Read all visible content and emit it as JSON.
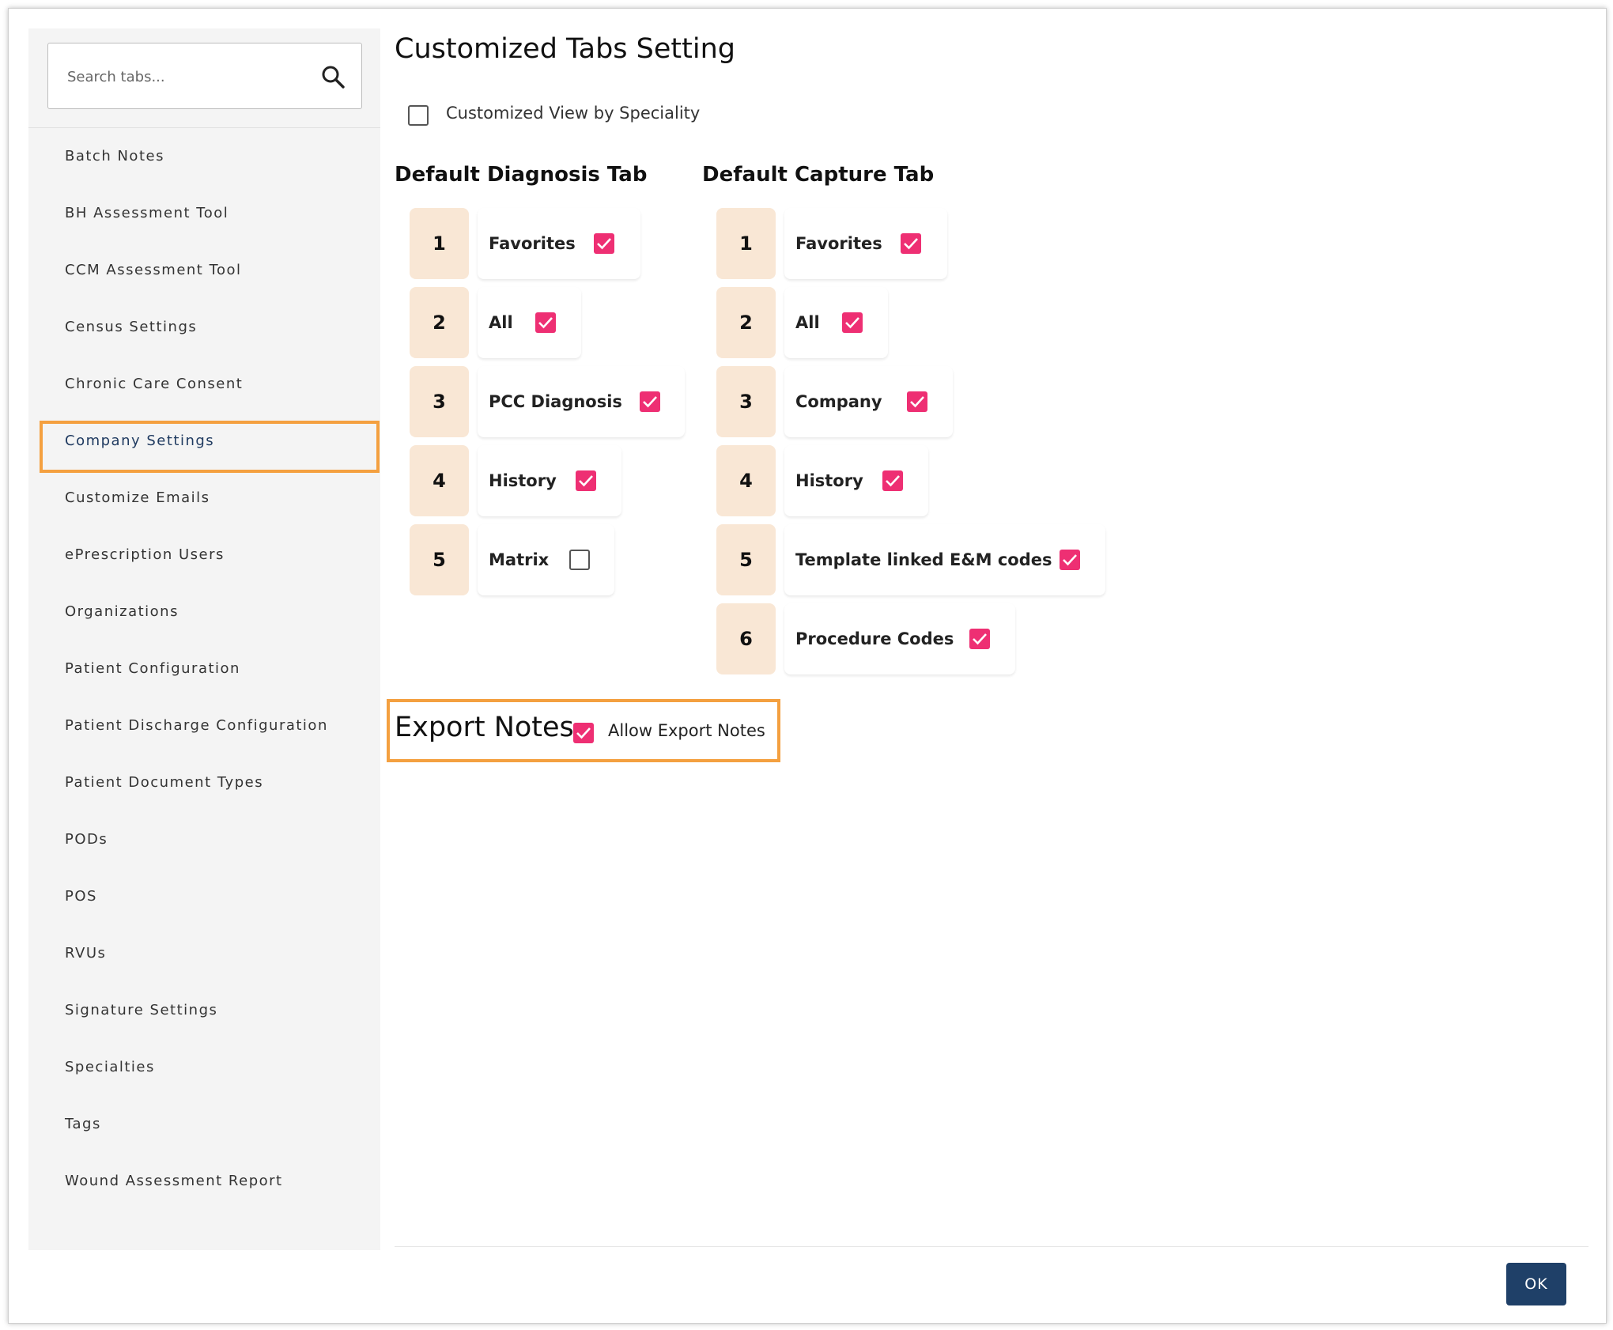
{
  "sidebar": {
    "search_placeholder": "Search tabs...",
    "items": [
      "Batch Notes",
      "BH Assessment Tool",
      "CCM Assessment Tool",
      "Census Settings",
      "Chronic Care Consent",
      "Company Settings",
      "Customize Emails",
      "ePrescription Users",
      "Organizations",
      "Patient Configuration",
      "Patient Discharge Configuration",
      "Patient Document Types",
      "PODs",
      "POS",
      "RVUs",
      "Signature Settings",
      "Specialties",
      "Tags",
      "Wound Assessment Report"
    ],
    "active_item": "Company Settings"
  },
  "main": {
    "title": "Customized Tabs Setting",
    "customized_view_label": "Customized View by Speciality",
    "customized_view_checked": false,
    "diagnosis": {
      "heading": "Default Diagnosis Tab",
      "tabs": [
        {
          "num": "1",
          "label": "Favorites",
          "checked": true
        },
        {
          "num": "2",
          "label": "All",
          "checked": true
        },
        {
          "num": "3",
          "label": "PCC Diagnosis",
          "checked": true
        },
        {
          "num": "4",
          "label": "History",
          "checked": true
        },
        {
          "num": "5",
          "label": "Matrix",
          "checked": false
        }
      ]
    },
    "capture": {
      "heading": "Default Capture Tab",
      "tabs": [
        {
          "num": "1",
          "label": "Favorites",
          "checked": true
        },
        {
          "num": "2",
          "label": "All",
          "checked": true
        },
        {
          "num": "3",
          "label": "Company",
          "checked": true
        },
        {
          "num": "4",
          "label": "History",
          "checked": true
        },
        {
          "num": "5",
          "label": "Template linked E&M codes",
          "checked": true
        },
        {
          "num": "6",
          "label": "Procedure Codes",
          "checked": true
        }
      ]
    },
    "export": {
      "title": "Export Notes",
      "label": "Allow Export Notes",
      "checked": true
    }
  },
  "footer": {
    "ok_label": "OK"
  },
  "colors": {
    "accent_checkbox": "#ee2f73",
    "highlight": "#f4a040",
    "number_box": "#f9e7d5",
    "primary_button": "#1f4068",
    "active_nav_text": "#1f3a60"
  }
}
